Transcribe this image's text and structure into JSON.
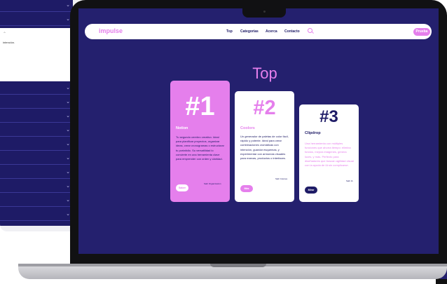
{
  "back_device": {
    "note": "intención."
  },
  "navbar": {
    "logo": "impulse",
    "links": [
      "Top",
      "Categorías",
      "Acerca",
      "Contacto"
    ],
    "cta": "Prueba"
  },
  "page": {
    "heading": "Top"
  },
  "cards": [
    {
      "rank": "#1",
      "title": "Notion",
      "description": "Tu segundo cerebro creativo. Ideal para planificar proyectos, organizar ideas, crear cronogramas o estructurar tu portafolio. Su versatilidad lo convierte en una herramienta clave para emprender con orden y claridad.",
      "credit": "Salir Organización",
      "button": "Saber"
    },
    {
      "rank": "#2",
      "title": "Coolors",
      "description": "Un generador de paletas de color fácil, rápido y potente. Ideal para crear combinaciones cromáticas con intención, guardar esquemas, y experimentar con armonías visuales para marcas, productos o interfaces.",
      "credit": "Salir Colores",
      "button": "Más"
    },
    {
      "rank": "#3",
      "title": "Clipdrop",
      "description": "Una herramienta con múltiples funciones que ahorra tiempo: elimina fondos, mejora imágenes, genera luces, y más. Perfecto para diseñadores que buscan agilidad visual con la ayuda de IA sin complicarse.",
      "credit": "Salir IA",
      "button": "Mirar"
    }
  ],
  "colors": {
    "primary_dark": "#24206e",
    "accent_pink": "#e57fec",
    "card_white": "#ffffff"
  }
}
